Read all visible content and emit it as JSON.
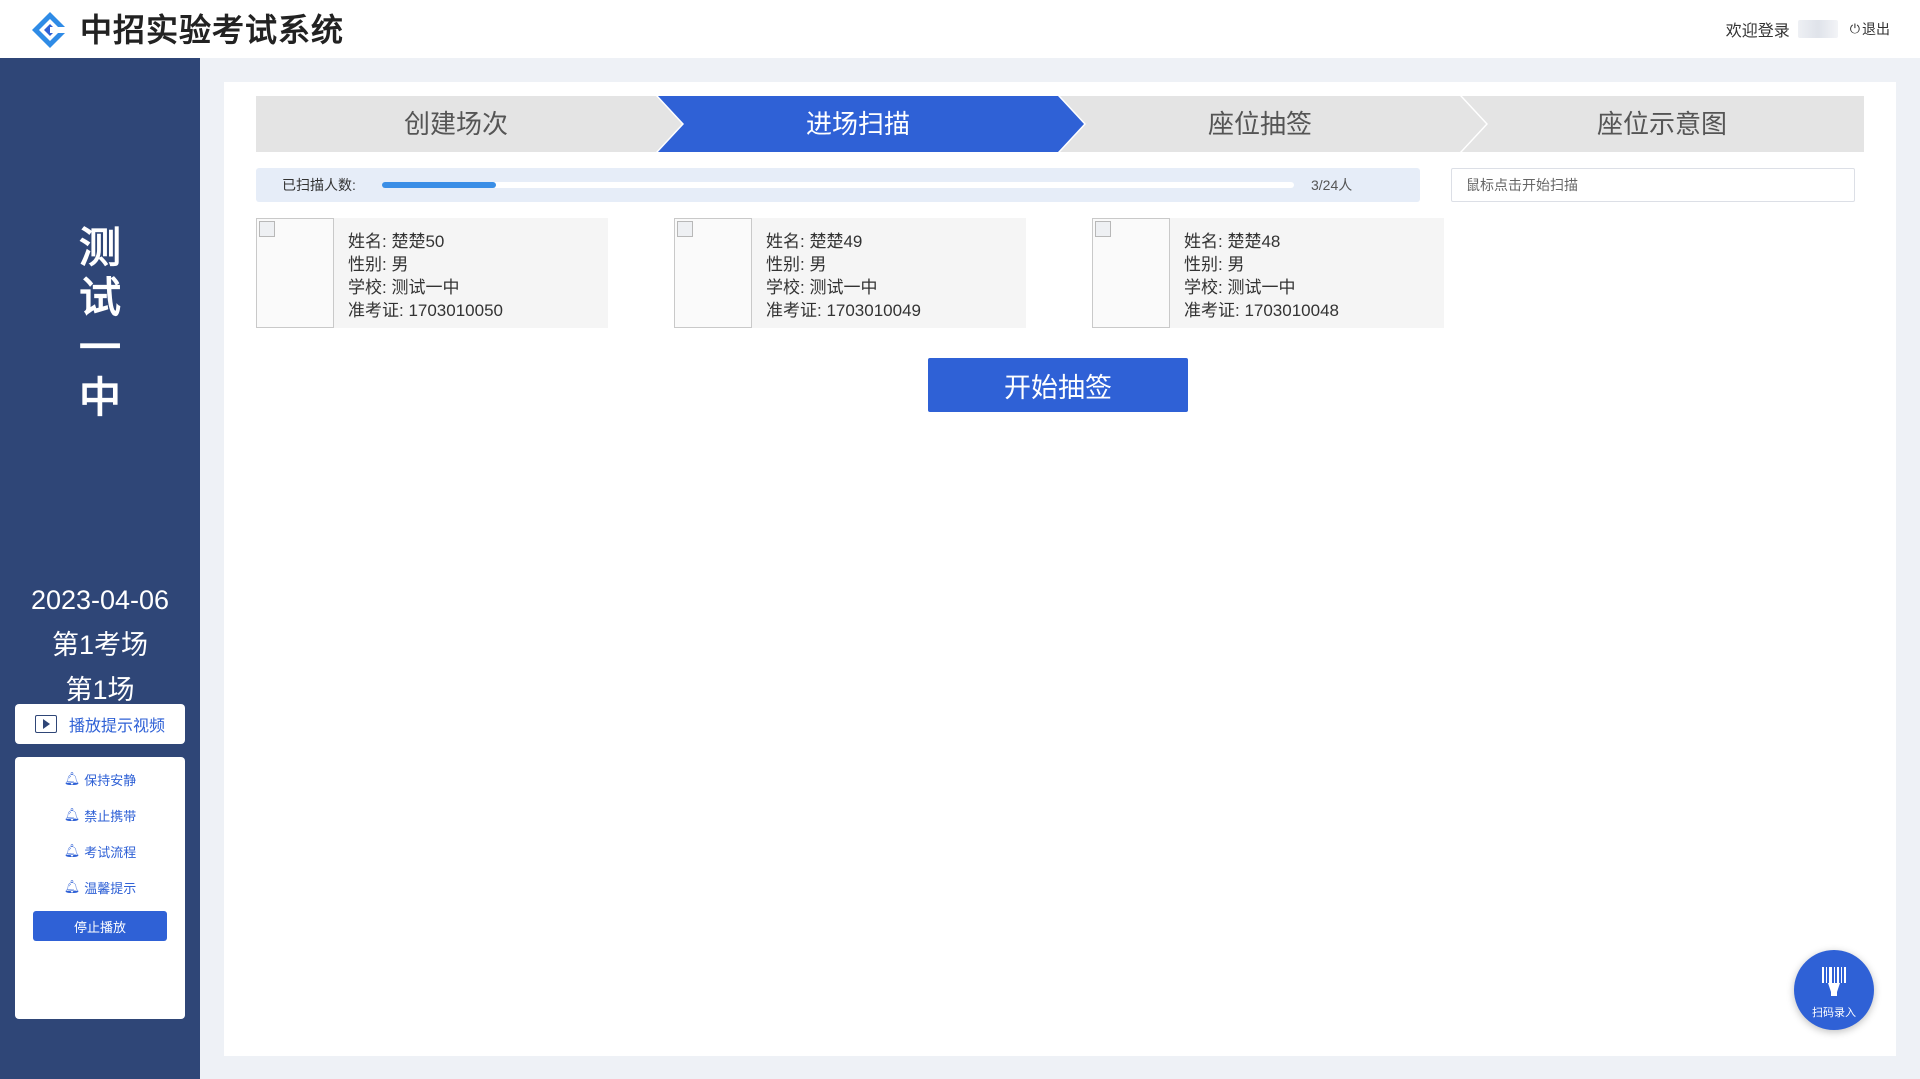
{
  "header": {
    "title": "中招实验考试系统",
    "welcome": "欢迎登录",
    "logout": "退出"
  },
  "sidebar": {
    "school_chars": [
      "测",
      "试",
      "一",
      "中"
    ],
    "date": "2023-04-06",
    "room": "第1考场",
    "session": "第1场",
    "video_button": "播放提示视频",
    "tips": [
      "保持安静",
      "禁止携带",
      "考试流程",
      "温馨提示"
    ],
    "stop_button": "停止播放"
  },
  "steps": [
    {
      "label": "创建场次",
      "active": false
    },
    {
      "label": "进场扫描",
      "active": true
    },
    {
      "label": "座位抽签",
      "active": false
    },
    {
      "label": "座位示意图",
      "active": false
    }
  ],
  "progress": {
    "label": "已扫描人数:",
    "scanned": 3,
    "total": 24,
    "count_text": "3/24人"
  },
  "scan": {
    "placeholder": "鼠标点击开始扫描"
  },
  "students": [
    {
      "name": "姓名: 楚楚50",
      "gender": "性别: 男",
      "school": "学校: 测试一中",
      "ticket": "准考证: 1703010050"
    },
    {
      "name": "姓名: 楚楚49",
      "gender": "性别: 男",
      "school": "学校: 测试一中",
      "ticket": "准考证: 1703010049"
    },
    {
      "name": "姓名: 楚楚48",
      "gender": "性别: 男",
      "school": "学校: 测试一中",
      "ticket": "准考证: 1703010048"
    }
  ],
  "draw_button": "开始抽签",
  "fab_label": "扫码录入",
  "colors": {
    "primary": "#2f61d6",
    "sidebar": "#2f4677",
    "step_inactive": "#e4e4e4",
    "progress": "#3a8ee6"
  },
  "icons": {
    "logo": "diamond-logo-icon",
    "logout": "power-icon",
    "video": "play-icon",
    "tips": "bell-icon",
    "fab": "barcode-scan-icon"
  }
}
